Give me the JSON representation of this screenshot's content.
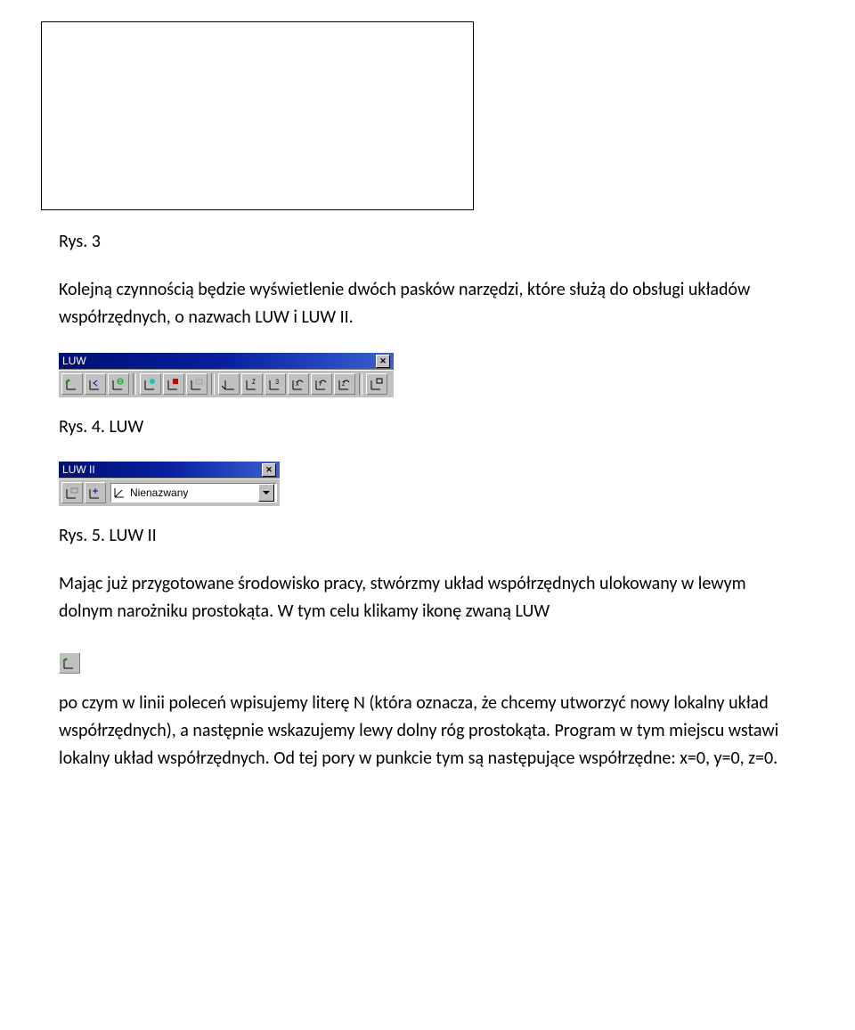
{
  "captions": {
    "fig3": "Rys. 3",
    "fig4": "Rys. 4. LUW",
    "fig5": "Rys. 5. LUW II"
  },
  "paragraphs": {
    "p1": "Kolejną czynnością będzie wyświetlenie dwóch pasków narzędzi, które służą do obsługi układów współrzędnych, o nazwach LUW i LUW II.",
    "p2": "Mając już przygotowane środowisko pracy, stwórzmy układ współrzędnych ulokowany w lewym dolnym narożniku prostokąta. W tym celu klikamy ikonę zwaną LUW",
    "p3": "po czym w linii poleceń wpisujemy literę N (która oznacza, że chcemy utworzyć nowy lokalny układ współrzędnych), a następnie wskazujemy lewy dolny róg prostokąta. Program w tym miejscu wstawi lokalny układ współrzędnych. Od tej pory w punkcie tym są następujące współrzędne: x=0, y=0, z=0."
  },
  "toolbars": {
    "luw": {
      "title": "LUW",
      "icons": [
        "luw-icon",
        "ucs-previous-icon",
        "ucs-world-icon",
        "ucs-object-icon",
        "ucs-face-icon",
        "ucs-view-icon",
        "ucs-origin-icon",
        "ucs-zaxis-icon",
        "ucs-3point-icon",
        "ucs-rotate-x-icon",
        "ucs-rotate-y-icon",
        "ucs-rotate-z-icon",
        "ucs-apply-icon"
      ]
    },
    "luw2": {
      "title": "LUW II",
      "icons": [
        "ucs-named-icon",
        "ucs-move-icon"
      ],
      "dropdown": {
        "value": "Nienazwany"
      }
    }
  }
}
